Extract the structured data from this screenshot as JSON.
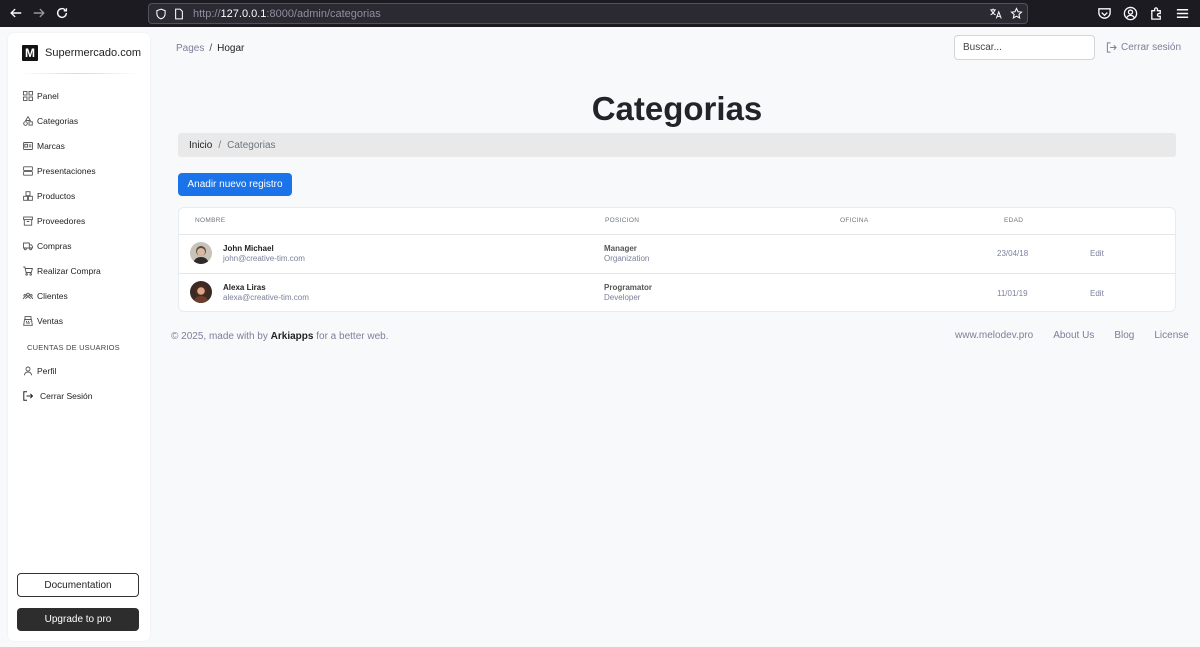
{
  "browser": {
    "url_scheme": "http://",
    "url_host": "127.0.0.1",
    "url_path": ":8000/admin/categorias"
  },
  "sidebar": {
    "brand_letter": "M",
    "brand_name": "Supermercado.com",
    "items": [
      {
        "label": "Panel",
        "icon": "dashboard-icon"
      },
      {
        "label": "Categorias",
        "icon": "shapes-icon"
      },
      {
        "label": "Marcas",
        "icon": "id-card-icon"
      },
      {
        "label": "Presentaciones",
        "icon": "server-icon"
      },
      {
        "label": "Productos",
        "icon": "boxes-icon"
      },
      {
        "label": "Proveedores",
        "icon": "archive-icon"
      },
      {
        "label": "Compras",
        "icon": "truck-icon"
      },
      {
        "label": "Realizar Compra",
        "icon": "cart-icon"
      },
      {
        "label": "Clientes",
        "icon": "users-icon"
      },
      {
        "label": "Ventas",
        "icon": "cash-register-icon"
      }
    ],
    "accounts_heading": "CUENTAS DE USUARIOS",
    "profile_label": "Perfil",
    "logout_label": "Cerrar Sesión",
    "documentation_label": "Documentation",
    "upgrade_label": "Upgrade to pro"
  },
  "topnav": {
    "crumb_root": "Pages",
    "crumb_sep": "/",
    "crumb_current": "Hogar",
    "search_placeholder": "Buscar...",
    "logout_label": "Cerrar sesión"
  },
  "page": {
    "title": "Categorias",
    "breadcrumb_home": "Inicio",
    "breadcrumb_sep": "/",
    "breadcrumb_current": "Categorias",
    "add_button": "Anadir nuevo registro"
  },
  "table": {
    "headers": [
      "NOMBRE",
      "POSICION",
      "OFICINA",
      "EDAD"
    ],
    "rows": [
      {
        "name": "John Michael",
        "email": "john@creative-tim.com",
        "role": "Manager",
        "dept": "Organization",
        "date": "23/04/18",
        "action": "Edit"
      },
      {
        "name": "Alexa Liras",
        "email": "alexa@creative-tim.com",
        "role": "Programator",
        "dept": "Developer",
        "date": "11/01/19",
        "action": "Edit"
      }
    ]
  },
  "footer": {
    "copy_prefix": "© 2025, made with by",
    "copy_brand": "Arkiapps",
    "copy_suffix": "for a better web.",
    "links": [
      "www.melodev.pro",
      "About Us",
      "Blog",
      "License"
    ]
  },
  "colors": {
    "primary": "#1a73e8",
    "browser_bar": "#1c1b22",
    "page_bg": "#f8f9fa"
  }
}
